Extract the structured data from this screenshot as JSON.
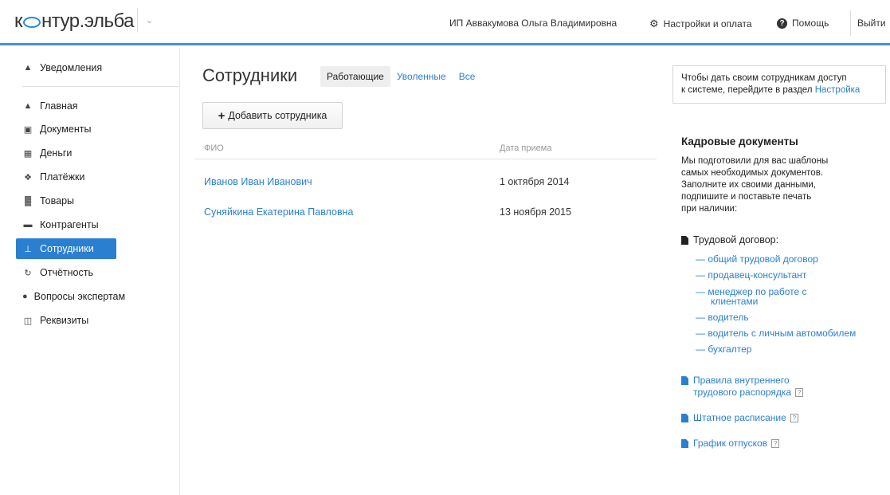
{
  "header": {
    "logo": {
      "part1": "к",
      "part2": "нтур.эльба"
    },
    "user_name": "ИП Аввакумова Ольга Владимировна",
    "settings_label": "Настройки и оплата",
    "help_label": "Помощь",
    "logout_label": "Выйти",
    "accent_color": "#4a90d4"
  },
  "sidebar": {
    "notifications": "Уведомления",
    "items": [
      {
        "label": "Главная",
        "icon": "home-icon"
      },
      {
        "label": "Документы",
        "icon": "documents-icon"
      },
      {
        "label": "Деньги",
        "icon": "money-icon"
      },
      {
        "label": "Платёжки",
        "icon": "payments-icon"
      },
      {
        "label": "Товары",
        "icon": "cart-icon"
      },
      {
        "label": "Контрагенты",
        "icon": "briefcase-icon"
      },
      {
        "label": "Сотрудники",
        "icon": "user-icon",
        "active": true
      },
      {
        "label": "Отчётность",
        "icon": "report-icon"
      },
      {
        "label": "Вопросы экспертам",
        "icon": "question-icon"
      },
      {
        "label": "Реквизиты",
        "icon": "details-icon"
      }
    ]
  },
  "main": {
    "title": "Сотрудники",
    "tabs": [
      {
        "label": "Работающие",
        "active": true
      },
      {
        "label": "Уволенные"
      },
      {
        "label": "Все"
      }
    ],
    "add_button": "Добавить сотрудника",
    "columns": {
      "name": "ФИО",
      "date": "Дата приема"
    },
    "rows": [
      {
        "name": "Иванов Иван Иванович",
        "date": "1 октября 2014"
      },
      {
        "name": "Суняйкина Екатерина Павловна",
        "date": "13 ноября 2015"
      }
    ]
  },
  "right": {
    "info_text_1": "Чтобы дать своим сотрудникам доступ",
    "info_text_2": "к системе, перейдите в раздел",
    "info_link": "Настройка",
    "hr_title": "Кадровые документы",
    "hr_desc_lines": [
      "Мы подготовили для вас шаблоны",
      "самых необходимых документов.",
      "Заполните их своими данными,",
      "подпишите и поставьте печать",
      "при наличии:"
    ],
    "contract_head": "Трудовой договор:",
    "contract_links": [
      "— общий трудовой договор",
      "— продавец-консультант",
      "— менеджер по работе с",
      "клиентами",
      "— водитель",
      "— водитель с личным автомобилем",
      "— бухгалтер"
    ],
    "docs": [
      {
        "line1": "Правила внутреннего",
        "line2": "трудового распорядка"
      },
      {
        "line1": "Штатное расписание"
      },
      {
        "line1": "График отпусков"
      }
    ],
    "help_glyph": "?"
  }
}
